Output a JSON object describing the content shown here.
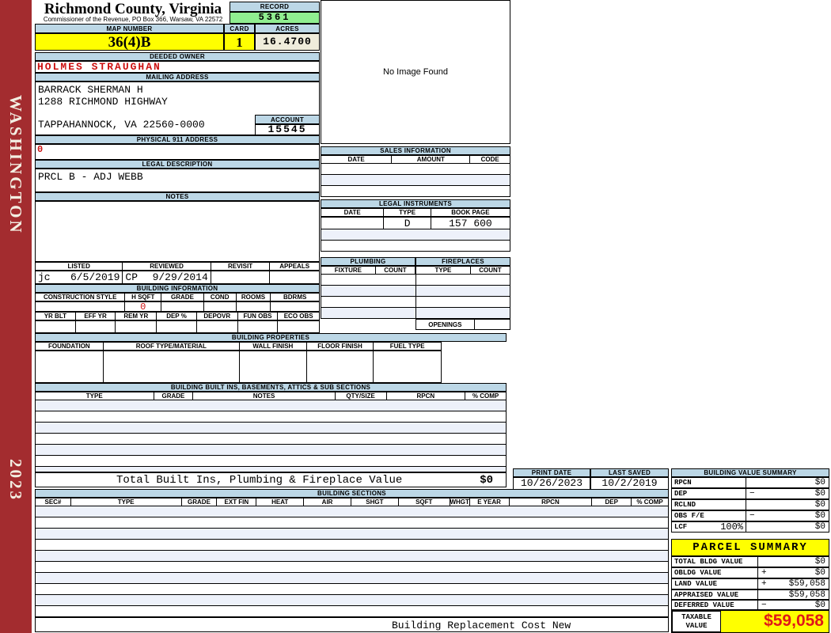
{
  "sidebar": {
    "county": "WASHINGTON",
    "year": "2023"
  },
  "header": {
    "title": "Richmond County, Virginia",
    "subtitle": "Commissioner of the Revenue,  PO Box 366, Warsaw, VA 22572",
    "record_label": "RECORD",
    "record_value": "5361",
    "map_number_label": "MAP NUMBER",
    "map_number": "36(4)B",
    "card_label": "CARD",
    "card_value": "1",
    "acres_label": "ACRES",
    "acres_value": "16.4700"
  },
  "owner": {
    "deeded_owner_label": "DEEDED OWNER",
    "deeded_owner": "HOLMES STRAUGHAN",
    "mailing_address_label": "MAILING ADDRESS",
    "mailing_line1": "BARRACK SHERMAN H",
    "mailing_line2": "1288 RICHMOND HIGHWAY",
    "mailing_city": "TAPPAHANNOCK, VA 22560-0000",
    "account_label": "ACCOUNT",
    "account_value": "15545",
    "physical_label": "PHYSICAL 911 ADDRESS",
    "physical_value": "0"
  },
  "legal": {
    "description_label": "LEGAL DESCRIPTION",
    "description": "PRCL B - ADJ WEBB",
    "notes_label": "NOTES",
    "notes": ""
  },
  "review": {
    "cols": [
      "LISTED",
      "REVIEWED",
      "REVISIT",
      "APPEALS"
    ],
    "listed_by": "jc",
    "listed_date": "6/5/2019",
    "reviewed_by": "CP",
    "reviewed_date": "9/29/2014",
    "revisit": "",
    "appeals": ""
  },
  "bi": {
    "title": "BUILDING INFORMATION",
    "cols1": [
      "CONSTRUCTION STYLE",
      "H SQFT",
      "GRADE",
      "COND",
      "ROOMS",
      "BDRMS"
    ],
    "h_sqft": "0",
    "cols2": [
      "YR BLT",
      "EFF YR",
      "REM YR",
      "DEP %",
      "DEPOVR",
      "FUN OBS",
      "ECO OBS"
    ]
  },
  "bp": {
    "title": "BUILDING PROPERTIES",
    "cols": [
      "FOUNDATION",
      "ROOF TYPE/MATERIAL",
      "WALL FINISH",
      "FLOOR FINISH",
      "FUEL TYPE"
    ]
  },
  "builtins": {
    "title": "BUILDING BUILT INS, BASEMENTS, ATTICS & SUB SECTIONS",
    "cols": [
      "TYPE",
      "GRADE",
      "NOTES",
      "QTY/SIZE",
      "RPCN",
      "% COMP"
    ],
    "total_label": "Total Built Ins, Plumbing & Fireplace Value",
    "total_value": "$0"
  },
  "image_box": {
    "text": "No Image Found"
  },
  "sales": {
    "title": "SALES INFORMATION",
    "cols": [
      "DATE",
      "AMOUNT",
      "CODE"
    ]
  },
  "instruments": {
    "title": "LEGAL INSTRUMENTS",
    "cols": [
      "DATE",
      "TYPE",
      "BOOK PAGE"
    ],
    "row_date": "",
    "row_type": "D",
    "row_book_page": "157 600"
  },
  "plumbing": {
    "title": "PLUMBING",
    "cols": [
      "FIXTURE",
      "COUNT"
    ]
  },
  "fireplaces": {
    "title": "FIREPLACES",
    "cols": [
      "TYPE",
      "COUNT"
    ],
    "openings_label": "OPENINGS"
  },
  "dates": {
    "print_label": "PRINT DATE",
    "print_value": "10/26/2023",
    "saved_label": "LAST SAVED",
    "saved_value": "10/2/2019"
  },
  "bvs": {
    "title": "BUILDING VALUE SUMMARY",
    "rows": [
      {
        "label": "RPCN",
        "op": "",
        "value": "$0"
      },
      {
        "label": "DEP",
        "op": "−",
        "value": "$0"
      },
      {
        "label": "RCLND",
        "op": "",
        "value": "$0"
      },
      {
        "label": "OBS F/E",
        "op": "−",
        "value": "$0"
      },
      {
        "label": "LCF",
        "op": "",
        "value": "$0"
      }
    ],
    "lcf_pct": "100%"
  },
  "sections": {
    "title": "BUILDING SECTIONS",
    "cols": [
      "SEC#",
      "TYPE",
      "GRADE",
      "EXT FIN",
      "HEAT",
      "AIR",
      "SHGT",
      "SQFT",
      "WHGT",
      "E YEAR",
      "RPCN",
      "DEP",
      "% COMP"
    ]
  },
  "parcel": {
    "title": "PARCEL SUMMARY",
    "rows": [
      {
        "label": "TOTAL BLDG VALUE",
        "op": "",
        "value": "$0"
      },
      {
        "label": "OBLDG VALUE",
        "op": "+",
        "value": "$0"
      },
      {
        "label": "LAND VALUE",
        "op": "+",
        "value": "$59,058"
      },
      {
        "label": "APPRAISED VALUE",
        "op": "",
        "value": "$59,058"
      },
      {
        "label": "DEFERRED VALUE",
        "op": "−",
        "value": "$0"
      }
    ],
    "taxable_line1": "TAXABLE",
    "taxable_line2": "VALUE",
    "taxable_value": "$59,058"
  },
  "footer": {
    "text": "Building Replacement Cost New"
  },
  "colors": {
    "band_blue": "#BCD7E6",
    "record_green": "#90EE90",
    "highlight_yellow": "#FFFF00",
    "acres_cream": "#EFECDB",
    "spine_red": "#A32C2F",
    "field_red": "#CC1111",
    "taxable_red": "#E01818",
    "stripe_blue": "#EDF1FA"
  }
}
